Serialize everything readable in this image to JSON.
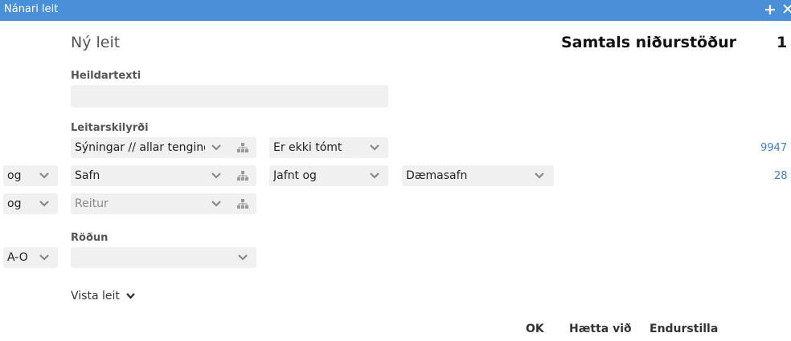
{
  "window": {
    "title": "Nánari leit"
  },
  "header": {
    "new_search": "Ný leit",
    "total_label": "Samtals niðurstöður",
    "total_count": "1"
  },
  "fulltext": {
    "label": "Heildartexti",
    "value": ""
  },
  "criteria": {
    "label": "Leitarskilyrði",
    "rows": [
      {
        "field": "Sýningar // allar tengingar",
        "operator": "Er ekki tómt",
        "count": "9947"
      },
      {
        "conjunction": "og",
        "field": "Safn",
        "operator": "Jafnt og",
        "value": "Dæmasafn",
        "count": "28"
      },
      {
        "conjunction": "og",
        "field_placeholder": "Reitur"
      }
    ]
  },
  "sort": {
    "label": "Röðun",
    "direction": "A-Ö",
    "field": ""
  },
  "show_search": "Vista leit",
  "buttons": {
    "ok": "OK",
    "cancel": "Hætta við",
    "reset": "Endurstilla"
  }
}
